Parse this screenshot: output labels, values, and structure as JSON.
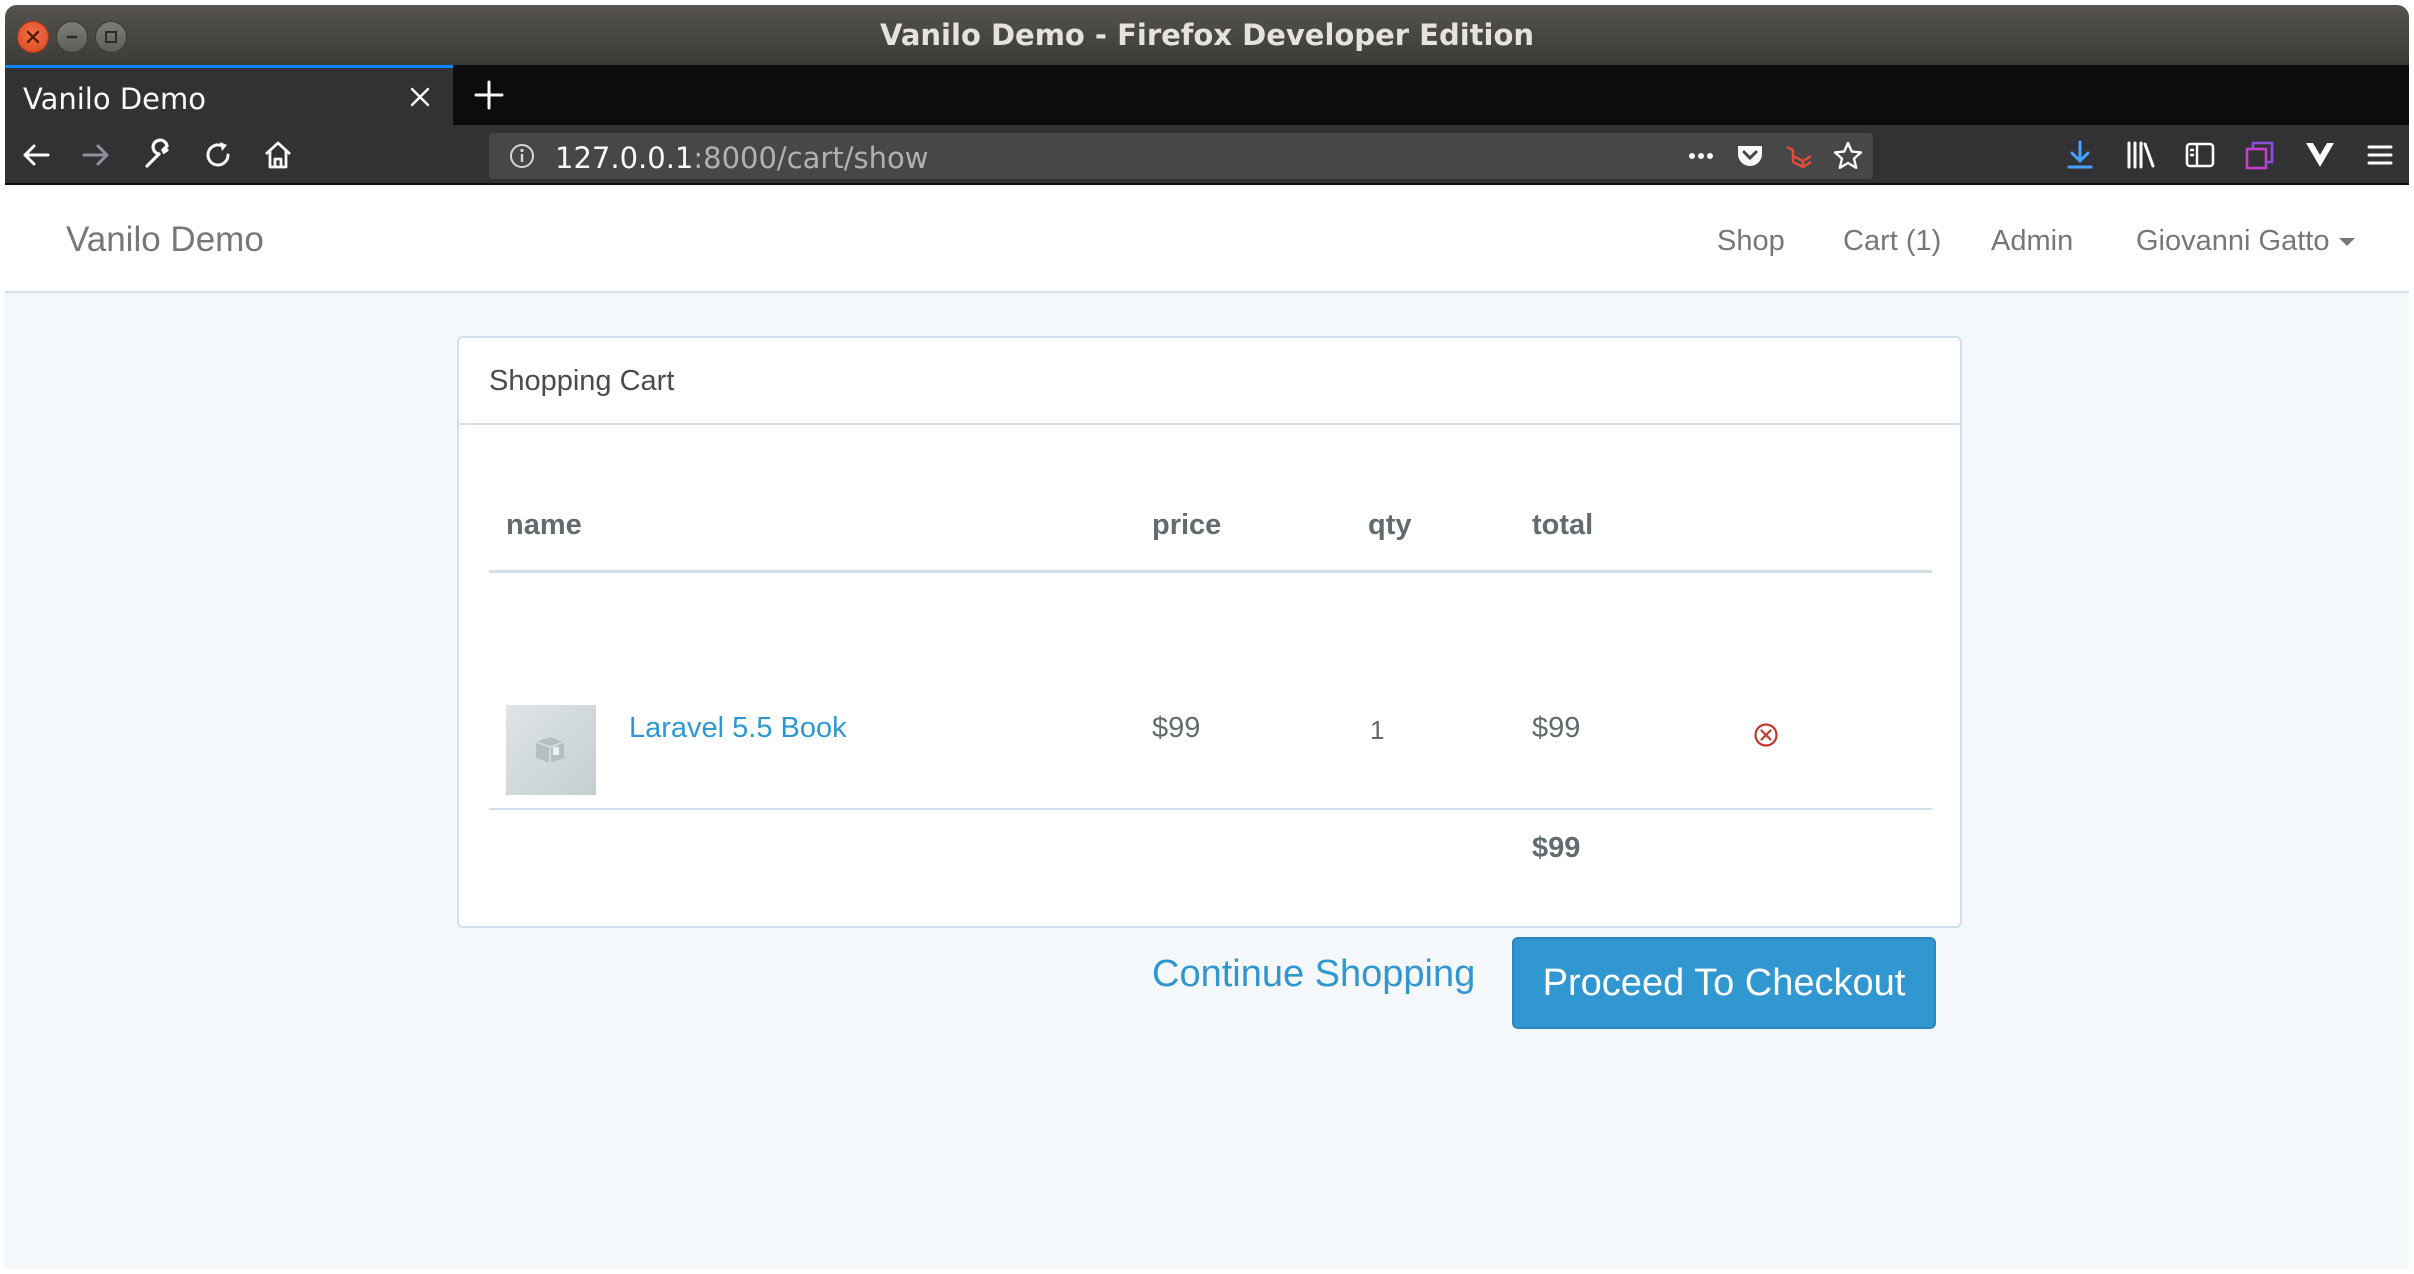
{
  "window": {
    "title": "Vanilo Demo - Firefox Developer Edition"
  },
  "browser": {
    "tab_label": "Vanilo Demo",
    "url_host": "127.0.0.1",
    "url_rest": ":8000/cart/show",
    "accent": "#0a84ff"
  },
  "site": {
    "brand": "Vanilo Demo",
    "nav": {
      "shop": "Shop",
      "cart": "Cart (1)",
      "admin": "Admin",
      "user": "Giovanni Gatto"
    }
  },
  "cart": {
    "heading": "Shopping Cart",
    "columns": {
      "name": "name",
      "price": "price",
      "qty": "qty",
      "total": "total"
    },
    "items": [
      {
        "name": "Laravel 5.5 Book",
        "price": "$99",
        "qty": "1",
        "total": "$99"
      }
    ],
    "grand_total": "$99",
    "continue_label": "Continue Shopping",
    "checkout_label": "Proceed To Checkout",
    "link_color": "#3097d1",
    "remove_color": "#c0392b"
  }
}
